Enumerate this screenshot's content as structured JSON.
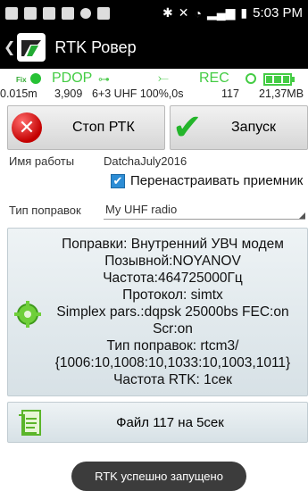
{
  "status_bar": {
    "time": "5:03 PM"
  },
  "action_bar": {
    "title": "RTK Ровер",
    "icons": {
      "back": "back-chevron-icon",
      "logo": "app-logo-icon"
    }
  },
  "info": {
    "fix_label": "Fix",
    "pdop_label": "PDOP",
    "rec_label": "REC",
    "precision": "0.015m",
    "value2": "3,909",
    "mode": "6+3 UHF 100%,0s",
    "count": "117",
    "storage": "21,37MB",
    "colors": {
      "status_green": "#44cc44",
      "fix_dot": "#27c235"
    }
  },
  "buttons": {
    "stop_label": "Стоп РТК",
    "start_label": "Запуск",
    "colors": {
      "stop": "#c30000",
      "start": "#24b52b"
    }
  },
  "job": {
    "label": "Имя работы",
    "value": "DatchaJuly2016"
  },
  "reconfigure": {
    "label": "Перенастраивать приемник",
    "checked": true
  },
  "corrections": {
    "label": "Тип поправок",
    "selected": "My UHF radio"
  },
  "panel": {
    "lines": [
      "Поправки: Внутренний УВЧ модем",
      "Позывной:NOYANOV",
      "Частота:464725000Гц",
      "Протокол: simtx",
      "Simplex pars.:dqpsk 25000bs FEC:on",
      "Scr:on",
      "Тип поправок: rtcm3/",
      "{1006:10,1008:10,1033:10,1003,1011}",
      "Частота RTK: 1сек"
    ]
  },
  "file_button": {
    "label": "Файл 117 на 5сек"
  },
  "toast": {
    "text": "RTK успешно запущено"
  }
}
